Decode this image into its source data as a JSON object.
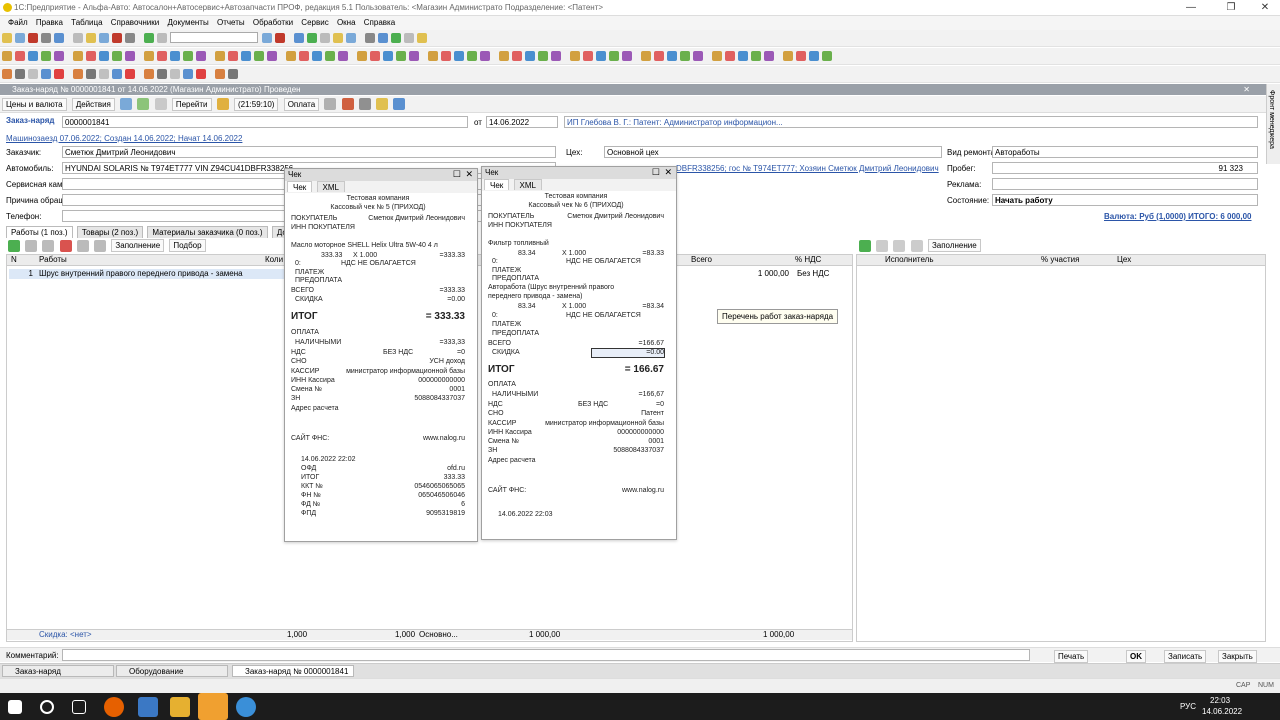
{
  "app": {
    "title": "1С:Предприятие - Альфа-Авто: Автосалон+Автосервис+Автозапчасти ПРОФ, редакция 5.1    Пользователь: <Магазин Администрато    Подразделение: <Патент>"
  },
  "menu": [
    "Файл",
    "Правка",
    "Таблица",
    "Справочники",
    "Документы",
    "Отчеты",
    "Обработки",
    "Сервис",
    "Окна",
    "Справка"
  ],
  "doc": {
    "title": "Заказ-наряд № 0000001841 от 14.06.2022 (Магазин Администрато) Проведен",
    "toolbar": {
      "prices": "Цены и валюта",
      "actions": "Действия",
      "goto": "Перейти",
      "time": "(21:59:10)",
      "payment": "Оплата"
    },
    "number_label": "Заказ-наряд",
    "number": "0000001841",
    "date_label": "от",
    "date": "14.06.2022",
    "org": "ИП Глебова В. Г.: Патент: Администратор информацион...",
    "info_link": "Машинозаезд 07.06.2022; Создан 14.06.2022; Начат 14.06.2022",
    "customer_label": "Заказчик:",
    "customer": "Сметюк Дмитрий Леонидович",
    "car_label": "Автомобиль:",
    "car": "HYUNDAI SOLARIS № Т974ЕТ777 VIN Z94CU41DBFR338256",
    "car_link": "DBFR338256; гос № Т974ЕТ777; Хозяин Сметюк Дмитрий Леонидович",
    "service_label": "Сервисная кам...",
    "reason_label": "Причина обращ...",
    "phone_label": "Телефон:",
    "shop_label": "Цех:",
    "shop": "Основной цех",
    "repair_label": "Вид ремонта:",
    "repair": "Автоработы",
    "mileage_label": "Пробег:",
    "mileage": "91 323",
    "ad_label": "Реклама:",
    "state_label": "Состояние:",
    "state": "Начать работу",
    "currency_link": "Валюта: Руб (1,0000) ИТОГО: 6 000,00"
  },
  "tabs": [
    "Работы (1 поз.)",
    "Товары (2 поз.)",
    "Материалы заказчика (0 поз.)",
    "Доп"
  ],
  "grid": {
    "fill": "Заполнение",
    "pick": "Подбор",
    "col_n": "N",
    "col_work": "Работы",
    "col_qty": "Коли",
    "col_total": "Всего",
    "col_vat": "% НДС",
    "rows": [
      {
        "n": "1",
        "work": "Шрус внутренний правого переднего привода - замена",
        "total": "1 000,00",
        "vat": "Без НДС"
      }
    ],
    "total_label": "Скидка: <нет>",
    "t1": "1,000",
    "t2": "1,000",
    "t3": "Основно...",
    "t4": "1 000,00",
    "t5": "1 000,00"
  },
  "right_grid": {
    "fill": "Заполнение",
    "col_exec": "Исполнитель",
    "col_part": "% участия",
    "col_shop": "Цех"
  },
  "tooltip": "Перечень работ заказ-наряда",
  "receipt1": {
    "title": "Чек",
    "tab_check": "Чек",
    "tab_xml": "XML",
    "company": "Тестовая компания",
    "header": "Кассовый чек № 5 (ПРИХОД)",
    "buyer_label": "ПОКУПАТЕЛЬ",
    "buyer": "Сметюк Дмитрий Леонидович",
    "inn_label": "ИНН ПОКУПАТЕЛЯ",
    "item": "Масло моторное SHELL Helix Ultra 5W-40 4 л",
    "qty_line_a": "333.33",
    "qty_line_x": "X  1.000",
    "qty_line_b": "=333.33",
    "zero": "0:",
    "novat": "НДС НЕ ОБЛАГАЕТСЯ",
    "payment": "ПЛАТЕЖ",
    "prepay": "ПРЕДОПЛАТА",
    "total_label": "ВСЕГО",
    "total_val": "=333.33",
    "disc_label": "СКИДКА",
    "disc_val": "=0.00",
    "itog_label": "ИТОГ",
    "itog_val": "= 333.33",
    "pay_label": "ОПЛАТА",
    "cash_label": "НАЛИЧНЫМИ",
    "cash_val": "=333,33",
    "vat_label": "НДС",
    "vat_mid": "БЕЗ НДС",
    "vat_val": "=0",
    "sno_label": "СНО",
    "sno_val": "УСН доход",
    "cashier_label": "КАССИР",
    "cashier_val": "министратор информационной базы",
    "inn_c_label": "ИНН Кассира",
    "inn_c_val": "000000000000",
    "shift_label": "Смена №",
    "shift_val": "0001",
    "zn_label": "ЗН",
    "zn_val": "5088084337037",
    "addr_label": "Адрес расчета",
    "fns_label": "САЙТ ФНС:",
    "fns_val": "www.nalog.ru",
    "dt": "14.06.2022   22:02",
    "ofd_label": "ОФД",
    "ofd_val": "ofd.ru",
    "itog2_label": "ИТОГ",
    "itog2_val": "333.33",
    "kkt_label": "ККТ №",
    "kkt_val": "0546065065065",
    "fn_label": "ФН №",
    "fn_val": "065046506046",
    "fd_label": "ФД №",
    "fd_val": "6",
    "fpd_label": "ФПД",
    "fpd_val": "9095319819"
  },
  "receipt2": {
    "title": "Чек",
    "tab_check": "Чек",
    "tab_xml": "XML",
    "company": "Тестовая компания",
    "header": "Кассовый чек № 6 (ПРИХОД)",
    "buyer_label": "ПОКУПАТЕЛЬ",
    "buyer": "Сметюк Дмитрий Леонидович",
    "inn_label": "ИНН ПОКУПАТЕЛЯ",
    "item1": "Фильтр топливный",
    "l1a": "83.34",
    "l1x": "X  1.000",
    "l1b": "=83.33",
    "zero": "0:",
    "novat": "НДС НЕ ОБЛАГАЕТСЯ",
    "payment": "ПЛАТЕЖ",
    "prepay": "ПРЕДОПЛАТА",
    "item2a": "Авторабота    (Шрус    внутренний    правого",
    "item2b": "переднего привода - замена)",
    "l2a": "83.34",
    "l2x": "X  1.000",
    "l2b": "=83.34",
    "total_label": "ВСЕГО",
    "total_val": "=166.67",
    "disc_label": "СКИДКА",
    "disc_val": "=0.00",
    "itog_label": "ИТОГ",
    "itog_val": "= 166.67",
    "pay_label": "ОПЛАТА",
    "cash_label": "НАЛИЧНЫМИ",
    "cash_val": "=166,67",
    "vat_label": "НДС",
    "vat_mid": "БЕЗ НДС",
    "vat_val": "=0",
    "sno_label": "СНО",
    "sno_val": "Патент",
    "cashier_label": "КАССИР",
    "cashier_val": "министратор информационной базы",
    "inn_c_label": "ИНН Кассира",
    "inn_c_val": "000000000000",
    "shift_label": "Смена №",
    "shift_val": "0001",
    "zn_label": "ЗН",
    "zn_val": "5088084337037",
    "addr_label": "Адрес расчета",
    "fns_label": "САЙТ ФНС:",
    "fns_val": "www.nalog.ru",
    "dt": "14.06.2022   22:03"
  },
  "bottom": {
    "comment_label": "Комментарий:",
    "print": "Печать",
    "ok": "OK",
    "save": "Записать",
    "close": "Закрыть"
  },
  "windows": [
    "Заказ-наряд",
    "Оборудование",
    "Заказ-наряд № 0000001841"
  ],
  "status": {
    "cap": "CAP",
    "num": "NUM"
  },
  "taskbar": {
    "lang": "РУС",
    "time": "22:03",
    "date": "14.06.2022"
  },
  "side": {
    "label": "Фронт менеджера"
  },
  "colors": {
    "accent": "#2b55a8",
    "header": "#9aa0a8"
  }
}
